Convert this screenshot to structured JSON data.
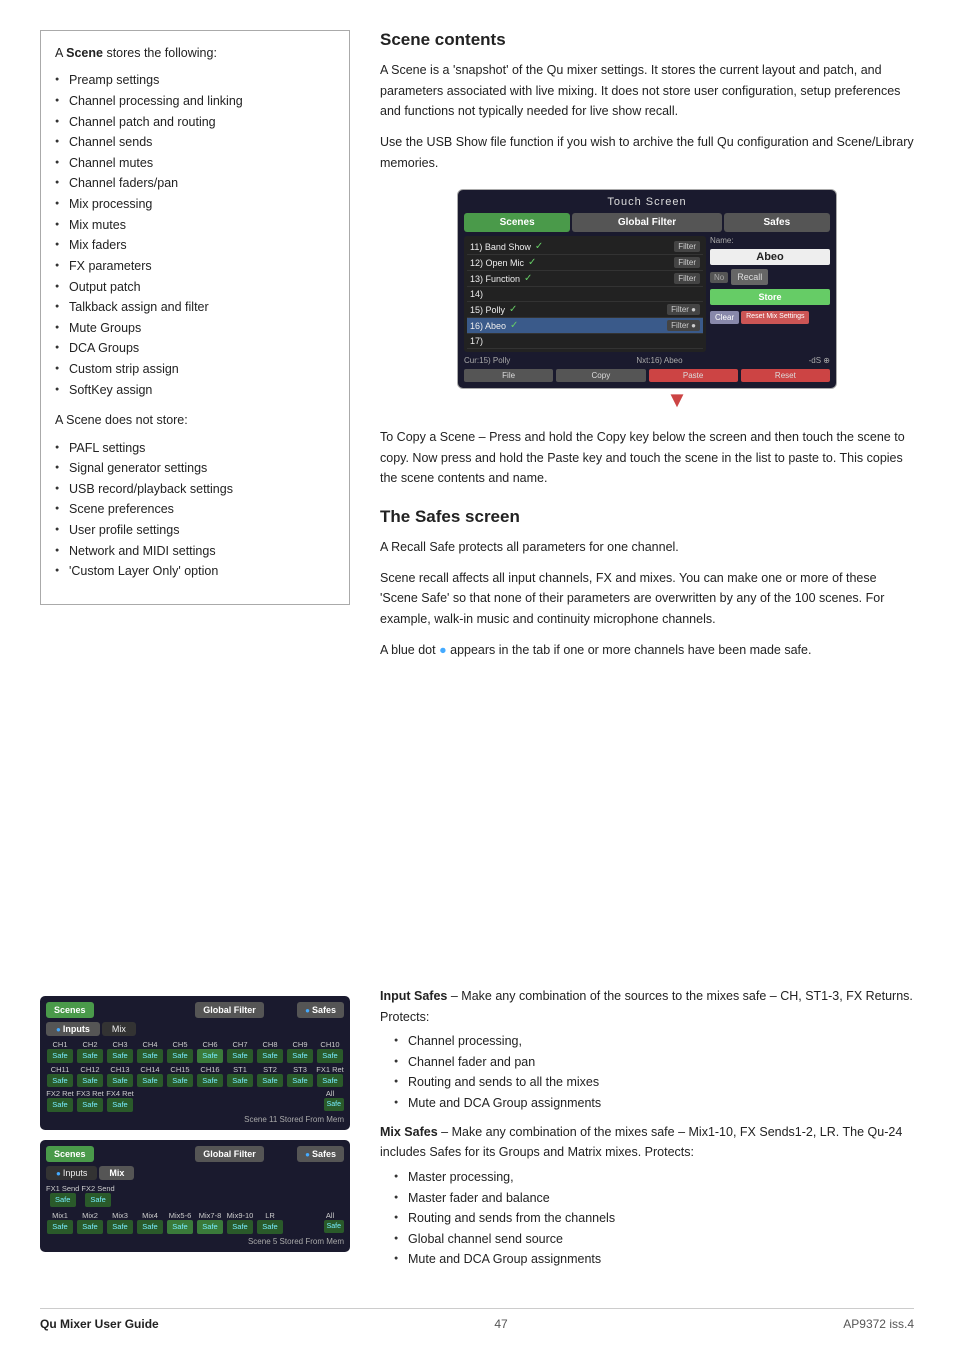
{
  "page": {
    "footer": {
      "left": "Qu Mixer User Guide",
      "center": "47",
      "right": "AP9372 iss.4"
    }
  },
  "left_box": {
    "intro": "A Scene stores the following:",
    "stores_items": [
      "Preamp settings",
      "Channel processing and linking",
      "Channel patch and routing",
      "Channel sends",
      "Channel mutes",
      "Channel faders/pan",
      "Mix processing",
      "Mix mutes",
      "Mix faders",
      "FX parameters",
      "Output patch",
      "Talkback assign and filter",
      "Mute Groups",
      "DCA Groups",
      "Custom strip assign",
      "SoftKey assign"
    ],
    "not_store_intro": "A Scene does not store:",
    "not_stores_items": [
      "PAFL settings",
      "Signal generator settings",
      "USB record/playback settings",
      "Scene preferences",
      "User profile settings",
      "Network and MIDI settings",
      "'Custom Layer Only' option"
    ]
  },
  "scene_contents": {
    "title": "Scene contents",
    "para1": "A Scene is a 'snapshot' of the Qu mixer settings. It stores the current layout and patch, and parameters associated with live mixing. It does not store user configuration, setup preferences and functions not typically needed for live show recall.",
    "para2": "Use the USB Show file function if you wish to archive the full Qu configuration and Scene/Library memories.",
    "touchscreen": {
      "title": "Touch Screen",
      "tabs": {
        "scenes": "Scenes",
        "global_filter": "Global Filter",
        "safes": "Safes"
      },
      "scenes_list": [
        {
          "name": "11) Band Show",
          "checked": true,
          "filter": "Filter"
        },
        {
          "name": "12) Open Mic",
          "checked": true,
          "filter": "Filter"
        },
        {
          "name": "13) Function",
          "checked": true,
          "filter": "Filter"
        },
        {
          "name": "14)",
          "checked": false,
          "filter": ""
        },
        {
          "name": "15) Polly",
          "checked": true,
          "filter": "Filter ●"
        },
        {
          "name": "16) Abeo",
          "checked": true,
          "filter": "Filter ●",
          "active": true
        },
        {
          "name": "17)",
          "checked": false,
          "filter": ""
        }
      ],
      "name_label": "Name:",
      "name_value": "Abeo",
      "recall_btn": "Recall",
      "store_btn": "Store",
      "clear_btn": "Clear",
      "reset_btn": "Reset Mix Settings",
      "cur_label": "Cur:15) Polly",
      "next_label": "Nxt:16) Abeo",
      "bottom_btns": {
        "file": "File",
        "copy": "Copy",
        "paste": "Paste",
        "reset": "Reset"
      }
    },
    "copy_scene_text": "To Copy a Scene – Press and hold the Copy key below the screen and then touch the scene to copy. Now press and hold the Paste key and touch the scene in the list to paste to. This copies the scene contents and name."
  },
  "safes_screen": {
    "title": "The Safes screen",
    "para1": "A Recall Safe protects all parameters for one channel.",
    "para2": "Scene recall affects all input channels, FX and mixes. You can make one or more of these 'Scene Safe' so that none of their parameters are overwritten by any of the 100 scenes. For example, walk-in music and continuity microphone channels.",
    "para3": "A blue dot ● appears in the tab if one or more channels have been made safe.",
    "inputs_ui": {
      "tabs": {
        "scenes": "Scenes",
        "global_filter": "Global Filter",
        "safes": "Safes"
      },
      "subtabs": {
        "inputs": "Inputs",
        "mix": "Mix"
      },
      "active_subtab": "Inputs",
      "channels": [
        "CH1",
        "CH2",
        "CH3",
        "CH4",
        "CH5",
        "CH6",
        "CH7",
        "CH8",
        "CH9",
        "CH10",
        "CH11",
        "CH12",
        "CH13",
        "CH14",
        "CH15",
        "CH16",
        "ST1",
        "ST2",
        "ST3",
        "FX1 Ret",
        "FX2 Ret",
        "FX3 Ret",
        "FX4 Ret"
      ],
      "safe_label": "Safe",
      "all_safe": "All Safe",
      "footer": "Scene 11 Stored From Mem"
    },
    "mix_ui": {
      "tabs": {
        "scenes": "Scenes",
        "global_filter": "Global Filter",
        "safes": "Safes"
      },
      "subtabs": {
        "inputs": "Inputs",
        "mix": "Mix"
      },
      "active_subtab": "Mix",
      "sends": [
        "FX1 Send",
        "FX2 Send"
      ],
      "mixes": [
        "Mix1",
        "Mix2",
        "Mix3",
        "Mix4",
        "Mix5-6",
        "Mix7-8",
        "Mix9-10",
        "LR"
      ],
      "safe_label": "Safe",
      "all_safe": "All Safe",
      "footer": "Scene 5 Stored From Mem"
    },
    "input_safes": {
      "heading": "Input Safes",
      "desc": "– Make any combination of the sources to the mixes safe – CH, ST1-3, FX Returns. Protects:",
      "items": [
        "Channel processing,",
        "Channel fader and pan",
        "Routing and sends to all the mixes",
        "Mute and DCA Group assignments"
      ]
    },
    "mix_safes": {
      "heading": "Mix Safes",
      "desc": "– Make any combination of the mixes safe – Mix1-10, FX Sends1-2, LR. The Qu-24 includes Safes for its Groups and Matrix mixes. Protects:",
      "items": [
        "Master processing,",
        "Master fader and balance",
        "Routing and sends from the channels",
        "Global channel send source",
        "Mute and DCA Group assignments"
      ]
    }
  }
}
